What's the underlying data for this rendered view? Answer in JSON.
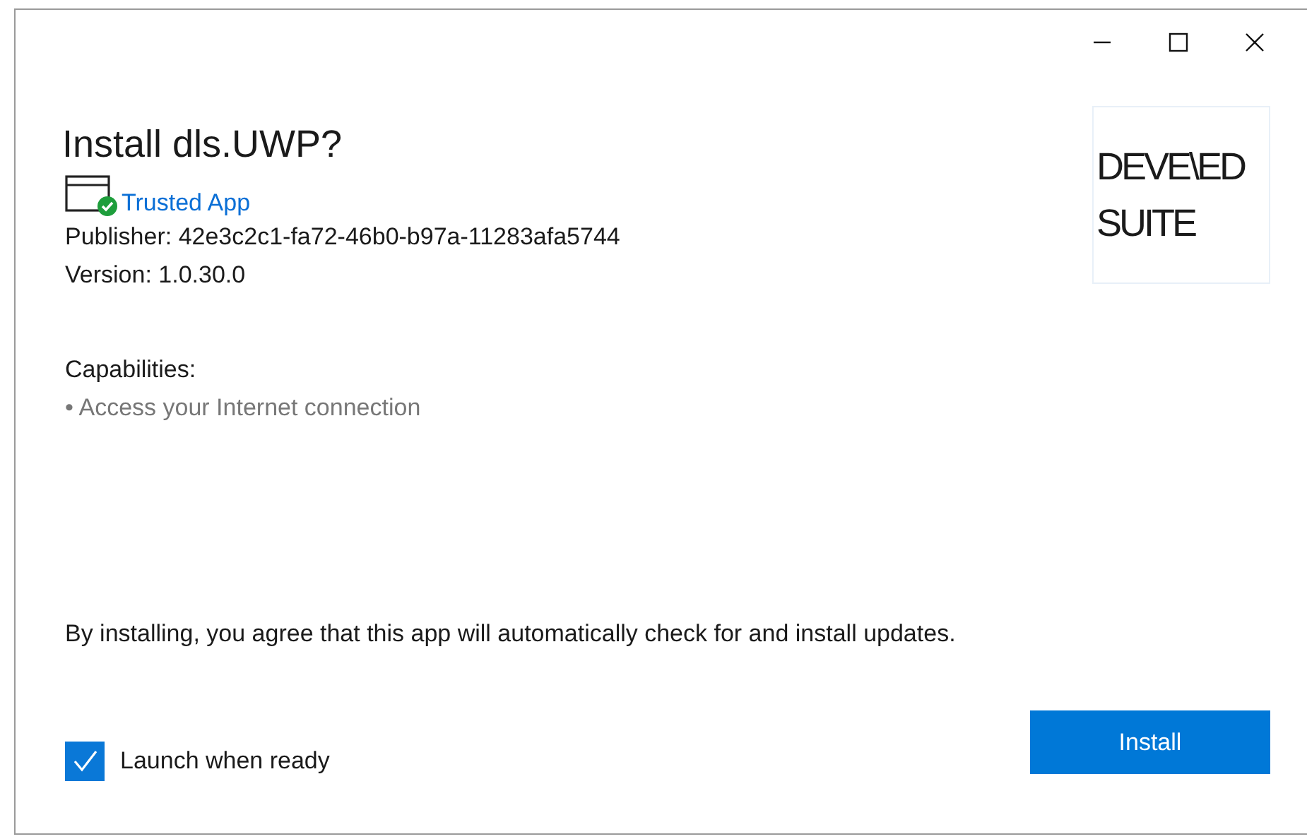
{
  "window": {
    "controls": [
      {
        "kind": "minimize"
      },
      {
        "kind": "maximize"
      },
      {
        "kind": "close"
      }
    ]
  },
  "title": "Install dls.UWP?",
  "trust": {
    "label": "Trusted App"
  },
  "publisher": "Publisher: 42e3c2c1-fa72-46b0-b97a-11283afa5744",
  "version": "Version: 1.0.30.0",
  "logo": {
    "lines": [
      "DEVE\\ED",
      "SUITE"
    ]
  },
  "capabilities": {
    "heading": "Capabilities:",
    "items": [
      "• Access your Internet connection"
    ]
  },
  "agreement": "By installing, you agree that this app will automatically check for and install updates.",
  "launch": {
    "label": "Launch when ready",
    "checked": true
  },
  "install_button": "Install"
}
